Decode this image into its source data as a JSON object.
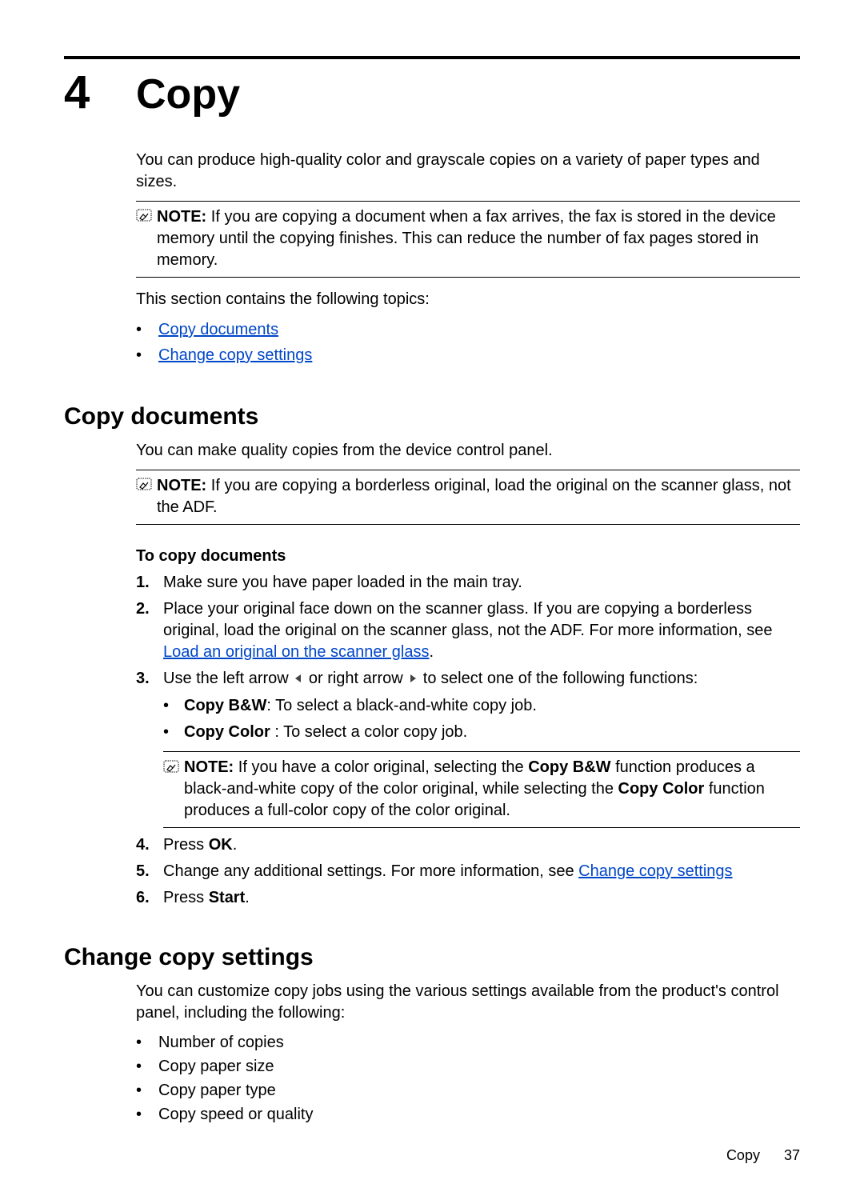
{
  "chapter": {
    "number": "4",
    "title": "Copy"
  },
  "intro": "You can produce high-quality color and grayscale copies on a variety of paper types and sizes.",
  "note1": {
    "label": "NOTE:",
    "text": "If you are copying a document when a fax arrives, the fax is stored in the device memory until the copying finishes. This can reduce the number of fax pages stored in memory."
  },
  "topics_intro": "This section contains the following topics:",
  "topics": [
    "Copy documents",
    "Change copy settings"
  ],
  "section1": {
    "title": "Copy documents",
    "intro": "You can make quality copies from the device control panel.",
    "note": {
      "label": "NOTE:",
      "text": "If you are copying a borderless original, load the original on the scanner glass, not the ADF."
    },
    "procedure_title": "To copy documents",
    "steps": {
      "s1": "Make sure you have paper loaded in the main tray.",
      "s2a": "Place your original face down on the scanner glass. If you are copying a borderless original, load the original on the scanner glass, not the ADF. For more information, see ",
      "s2_link": "Load an original on the scanner glass",
      "s2b": ".",
      "s3a": "Use the left arrow ",
      "s3b": " or right arrow ",
      "s3c": " to select one of the following functions:",
      "s3_bw_label": "Copy B&W",
      "s3_bw_text": ": To select a black-and-white copy job.",
      "s3_color_label": "Copy Color",
      "s3_color_text": " : To select a color copy job.",
      "s3_note_label": "NOTE:",
      "s3_note_a": "If you have a color original, selecting the ",
      "s3_note_bw": "Copy B&W",
      "s3_note_b": " function produces a black-and-white copy of the color original, while selecting the ",
      "s3_note_color": "Copy Color",
      "s3_note_c": " function produces a full-color copy of the color original.",
      "s4a": "Press ",
      "s4_ok": "OK",
      "s4b": ".",
      "s5a": "Change any additional settings. For more information, see ",
      "s5_link": "Change copy settings",
      "s6a": "Press ",
      "s6_start": "Start",
      "s6b": "."
    }
  },
  "section2": {
    "title": "Change copy settings",
    "intro": "You can customize copy jobs using the various settings available from the product's control panel, including the following:",
    "items": [
      "Number of copies",
      "Copy paper size",
      "Copy paper type",
      "Copy speed or quality"
    ]
  },
  "footer": {
    "label": "Copy",
    "page": "37"
  }
}
